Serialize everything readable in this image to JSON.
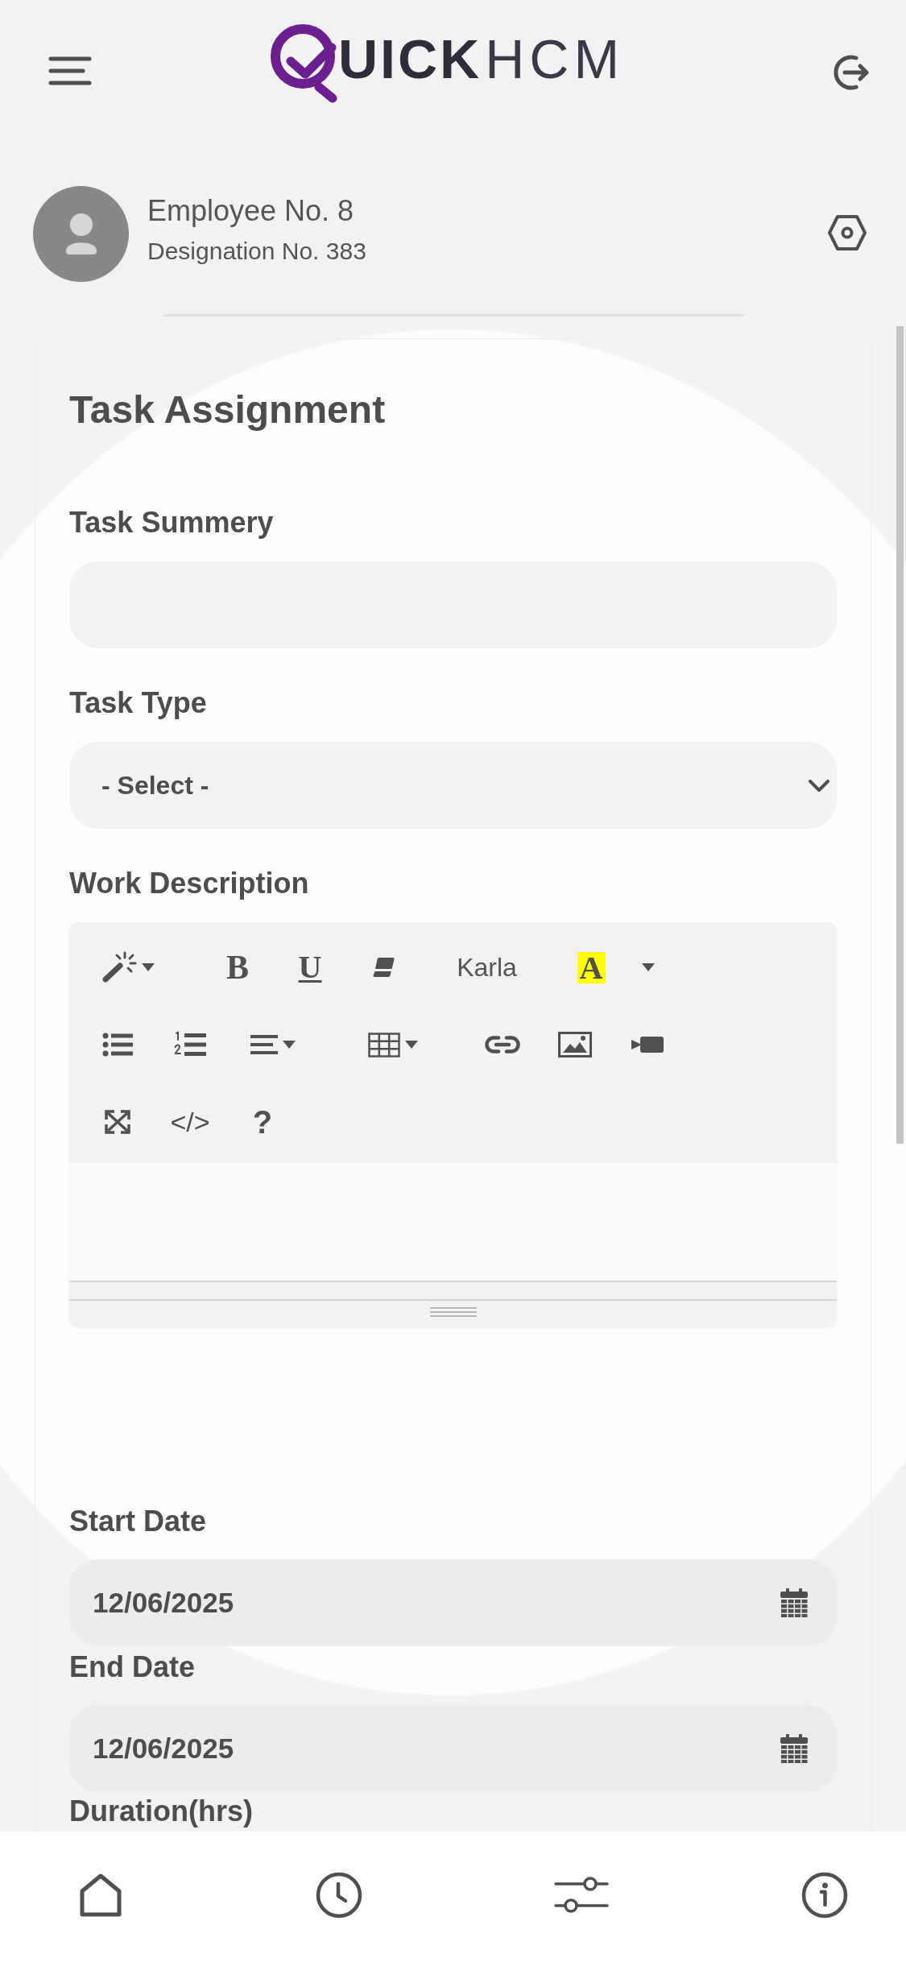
{
  "header": {
    "logo": {
      "bold": "UICK",
      "light": "HCM"
    }
  },
  "profile": {
    "name": "Employee No. 8",
    "designation": "Designation No. 383"
  },
  "form": {
    "title": "Task Assignment",
    "fields": [
      {
        "kind": "text",
        "label": "Task Summery"
      },
      {
        "kind": "select",
        "label": "Task Type",
        "value": "- Select -"
      },
      {
        "kind": "editor",
        "label": "Work Description",
        "toolbar": [
          [
            [
              {
                "kind": "style",
                "dropdown": true
              }
            ],
            [
              {
                "kind": "bold",
                "label": "B",
                "dropdown": false
              },
              {
                "kind": "underline",
                "label": "U",
                "dropdown": false
              },
              {
                "kind": "eraser",
                "dropdown": false
              }
            ],
            [
              {
                "kind": "font",
                "label": "Karla",
                "dropdown": false
              }
            ],
            [
              {
                "kind": "color",
                "label": "A",
                "color": "#ffff00",
                "dropdown": false
              },
              {
                "kind": "menu",
                "dropdown": true
              }
            ]
          ],
          [
            [
              {
                "kind": "ul",
                "dropdown": false
              },
              {
                "kind": "ol",
                "dropdown": false
              },
              {
                "kind": "align",
                "dropdown": true
              }
            ],
            [
              {
                "kind": "table",
                "dropdown": true
              }
            ],
            [
              {
                "kind": "link",
                "dropdown": false
              },
              {
                "kind": "picture",
                "dropdown": false
              },
              {
                "kind": "video",
                "dropdown": false
              }
            ]
          ],
          [
            [
              {
                "kind": "fullscreen",
                "dropdown": false
              },
              {
                "kind": "code",
                "label": "</>",
                "dropdown": false
              },
              {
                "kind": "help",
                "label": "?",
                "dropdown": false
              }
            ]
          ]
        ]
      },
      {
        "kind": "date",
        "label": "Start Date",
        "value": "12/06/2025"
      },
      {
        "kind": "date",
        "label": "End Date",
        "value": "12/06/2025"
      },
      {
        "kind": "label",
        "label": "Duration(hrs)"
      }
    ]
  }
}
